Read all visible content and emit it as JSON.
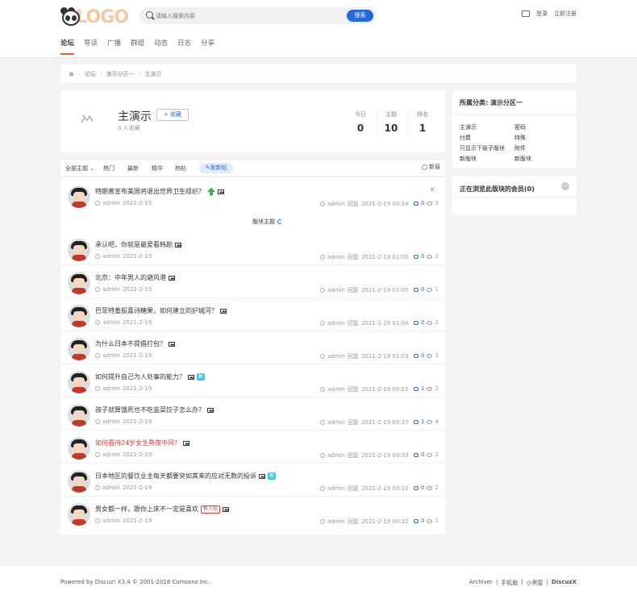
{
  "header": {
    "logo_text": "LOGO",
    "search_placeholder": "请输入搜索内容",
    "search_button": "搜索",
    "login": "登录",
    "register": "立即注册"
  },
  "nav": [
    {
      "label": "论坛",
      "active": true
    },
    {
      "label": "导读"
    },
    {
      "label": "广播"
    },
    {
      "label": "群组"
    },
    {
      "label": "动态"
    },
    {
      "label": "日志"
    },
    {
      "label": "分享"
    }
  ],
  "breadcrumb": [
    "论坛",
    "演示分区一",
    "主演示"
  ],
  "forum": {
    "name": "主演示",
    "fav_button": "+ 收藏",
    "fav_count": "0 人收藏",
    "stats": [
      {
        "label": "今日",
        "value": "0"
      },
      {
        "label": "主题",
        "value": "10"
      },
      {
        "label": "排名",
        "value": "1"
      }
    ]
  },
  "tabs": {
    "all": "全部主题",
    "hot": "热门",
    "latest": "最新",
    "digest": "精华",
    "hotposts": "热帖",
    "new_thread": "发新帖",
    "new_window": "新窗"
  },
  "separator_label": "版块主题",
  "threads": [
    {
      "title": "特朗普宣布美国将退出世界卫生组织？",
      "author": "admin",
      "date": "2021-2-19",
      "replier": "admin",
      "reply_label": "回复",
      "reply_time": "2021-2-19 00:34",
      "replies": "0",
      "views": "3",
      "sticky": true
    },
    {
      "title": "承认吧，你就是最爱看韩剧",
      "author": "admin",
      "date": "2021-2-19",
      "replier": "admin",
      "reply_label": "回复",
      "reply_time": "2021-2-19 01:05",
      "replies": "0",
      "views": "2"
    },
    {
      "title": "北京：中年男人的避风港",
      "author": "admin",
      "date": "2021-2-19",
      "replier": "admin",
      "reply_label": "回复",
      "reply_time": "2021-2-19 01:05",
      "replies": "0",
      "views": "1"
    },
    {
      "title": "巴菲特羞股喜诗糖果，如何建立的护城河？",
      "author": "admin",
      "date": "2021-2-19",
      "replier": "admin",
      "reply_label": "回复",
      "reply_time": "2021-2-19 01:04",
      "replies": "0",
      "views": "2"
    },
    {
      "title": "为什么日本不提倡打包？",
      "author": "admin",
      "date": "2021-2-19",
      "replier": "admin",
      "reply_label": "回复",
      "reply_time": "2021-2-19 01:03",
      "replies": "0",
      "views": "1"
    },
    {
      "title": "如何提升自己为人处事的能力？",
      "author": "admin",
      "date": "2021-2-19",
      "replier": "admin",
      "reply_label": "回复",
      "reply_time": "2021-2-19 00:51",
      "replies": "1",
      "views": "2",
      "badge": "新"
    },
    {
      "title": "孩子就算饿死也不吃韭菜饺子怎么办？",
      "author": "admin",
      "date": "2021-2-19",
      "replier": "admin",
      "reply_label": "回复",
      "reply_time": "2021-2-19 00:37",
      "replies": "1",
      "views": "4"
    },
    {
      "title": "如何看待24岁女生熬夜中风？",
      "author": "admin",
      "date": "2021-2-19",
      "replier": "admin",
      "reply_label": "回复",
      "reply_time": "2021-2-19 00:33",
      "replies": "0",
      "views": "2",
      "red": true
    },
    {
      "title": "日本地区的餐饮业主每天都要突如其来的应对无数的投诉",
      "author": "admin",
      "date": "2021-2-19",
      "replier": "admin",
      "reply_label": "回复",
      "reply_time": "2021-2-19 00:32",
      "replies": "0",
      "views": "2",
      "badge": "新"
    },
    {
      "title": "男女都一样，跟你上床不一定是喜欢",
      "author": "admin",
      "date": "2021-2-19",
      "replier": "admin",
      "reply_label": "回复",
      "reply_time": "2021-2-19 00:32",
      "replies": "0",
      "views": "1",
      "hot_badge": "新人帖"
    }
  ],
  "sidebar": {
    "category_title": "所属分类: 演示分区一",
    "subforums": [
      "主演示",
      "密码",
      "付费",
      "特殊",
      "只显示下级子版块",
      "附件",
      "新版块",
      "新版块"
    ],
    "online_title": "正在浏览此版块的会员(0)",
    "toggle": "−"
  },
  "footer": {
    "left": "Powered by Discuz! X3.4 © 2001-2018 Comsenz Inc.",
    "links": [
      "Archiver",
      "|",
      "手机版",
      "|",
      "小黑屋",
      "|",
      "DiscuzX"
    ]
  }
}
